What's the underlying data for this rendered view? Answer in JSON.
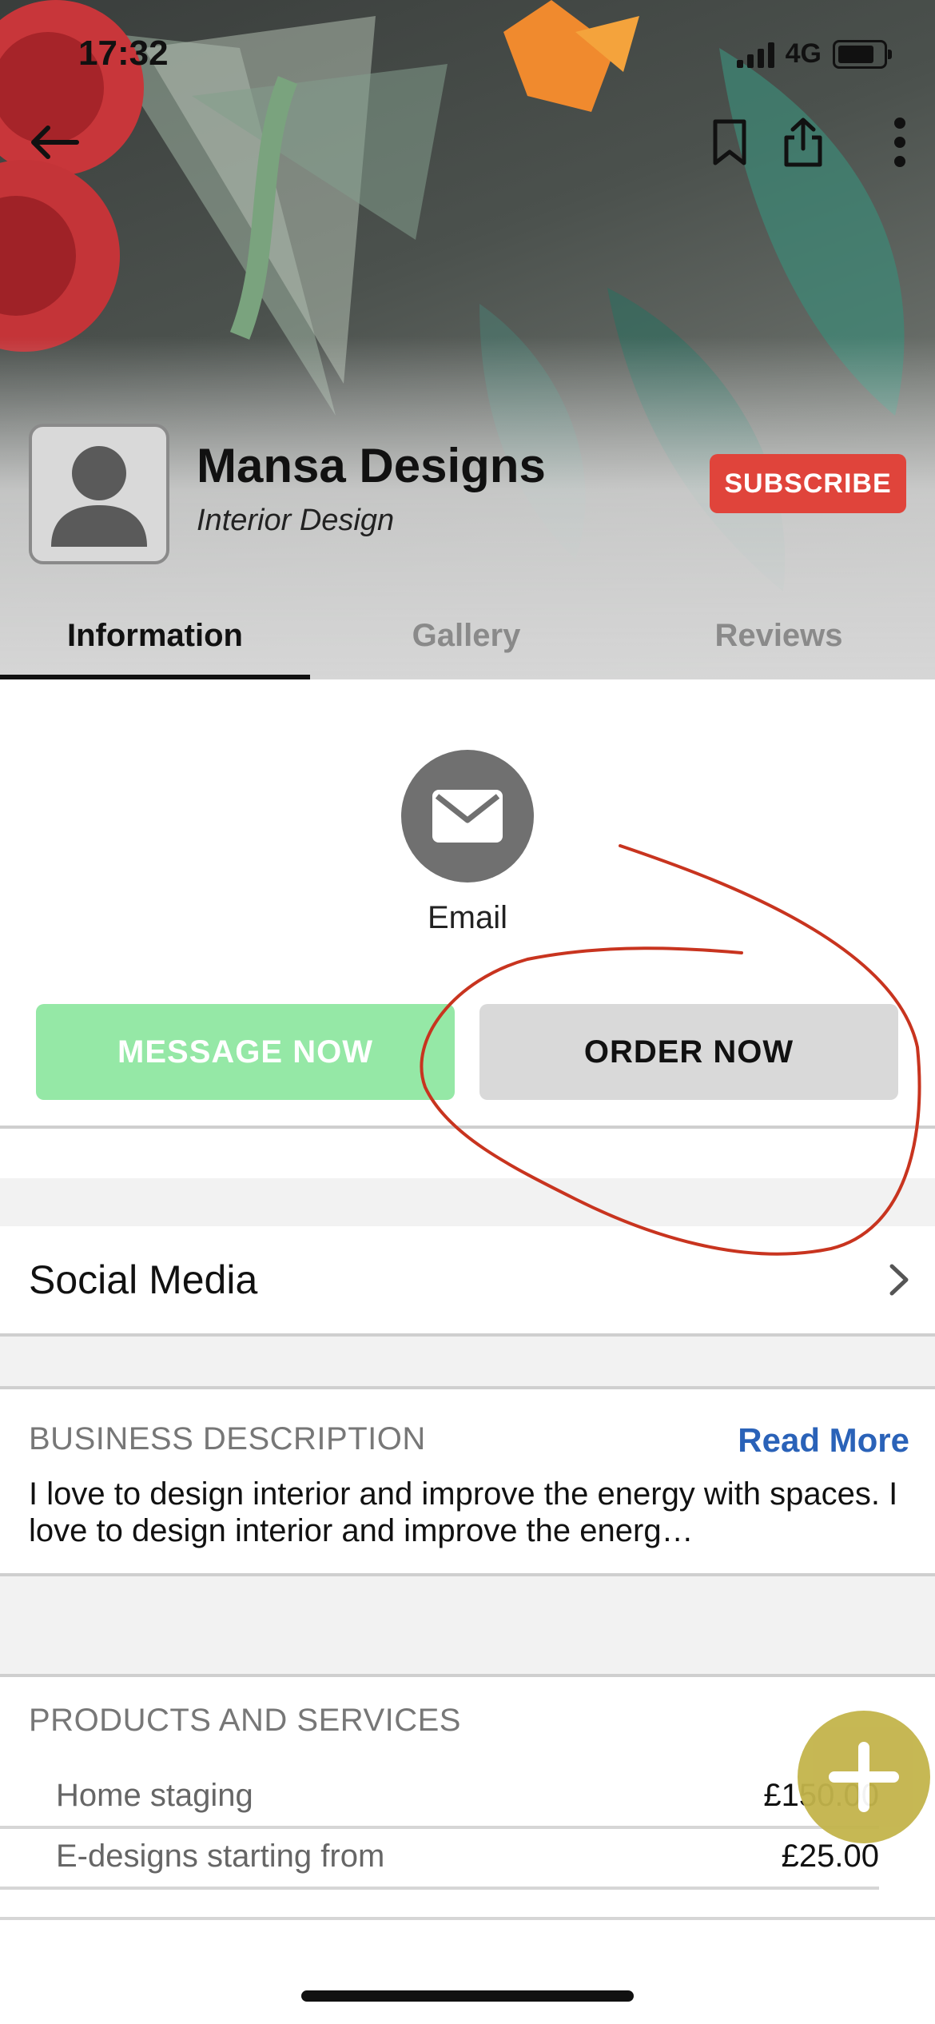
{
  "status_bar": {
    "time": "17:32",
    "network": "4G"
  },
  "header": {
    "back_icon": "arrow-left-icon",
    "bookmark_icon": "bookmark-icon",
    "share_icon": "share-icon",
    "more_icon": "more-vertical-icon"
  },
  "profile": {
    "name": "Mansa Designs",
    "category": "Interior Design",
    "subscribe_label": "SUBSCRIBE",
    "avatar_icon": "person-placeholder-icon"
  },
  "tabs": [
    {
      "label": "Information",
      "active": true
    },
    {
      "label": "Gallery",
      "active": false
    },
    {
      "label": "Reviews",
      "active": false
    }
  ],
  "contact": {
    "email_label": "Email",
    "email_icon": "envelope-icon"
  },
  "actions": {
    "message_label": "MESSAGE NOW",
    "order_label": "ORDER NOW"
  },
  "social": {
    "label": "Social Media"
  },
  "business_description": {
    "heading": "BUSINESS DESCRIPTION",
    "read_more": "Read More",
    "text": "I love to design interior and improve the energy with spaces. I love to design interior and improve the energ…"
  },
  "products": {
    "heading": "PRODUCTS AND SERVICES",
    "items": [
      {
        "name": "Home staging",
        "price": "£150.00"
      },
      {
        "name": "E-designs starting from",
        "price": "£25.00"
      }
    ]
  },
  "colors": {
    "subscribe": "#e0443b",
    "message_button": "#95e8a6",
    "order_button": "#d9d9d9",
    "link": "#2a62b8",
    "fab": "#c3b44b",
    "annotation": "#c8341f"
  }
}
